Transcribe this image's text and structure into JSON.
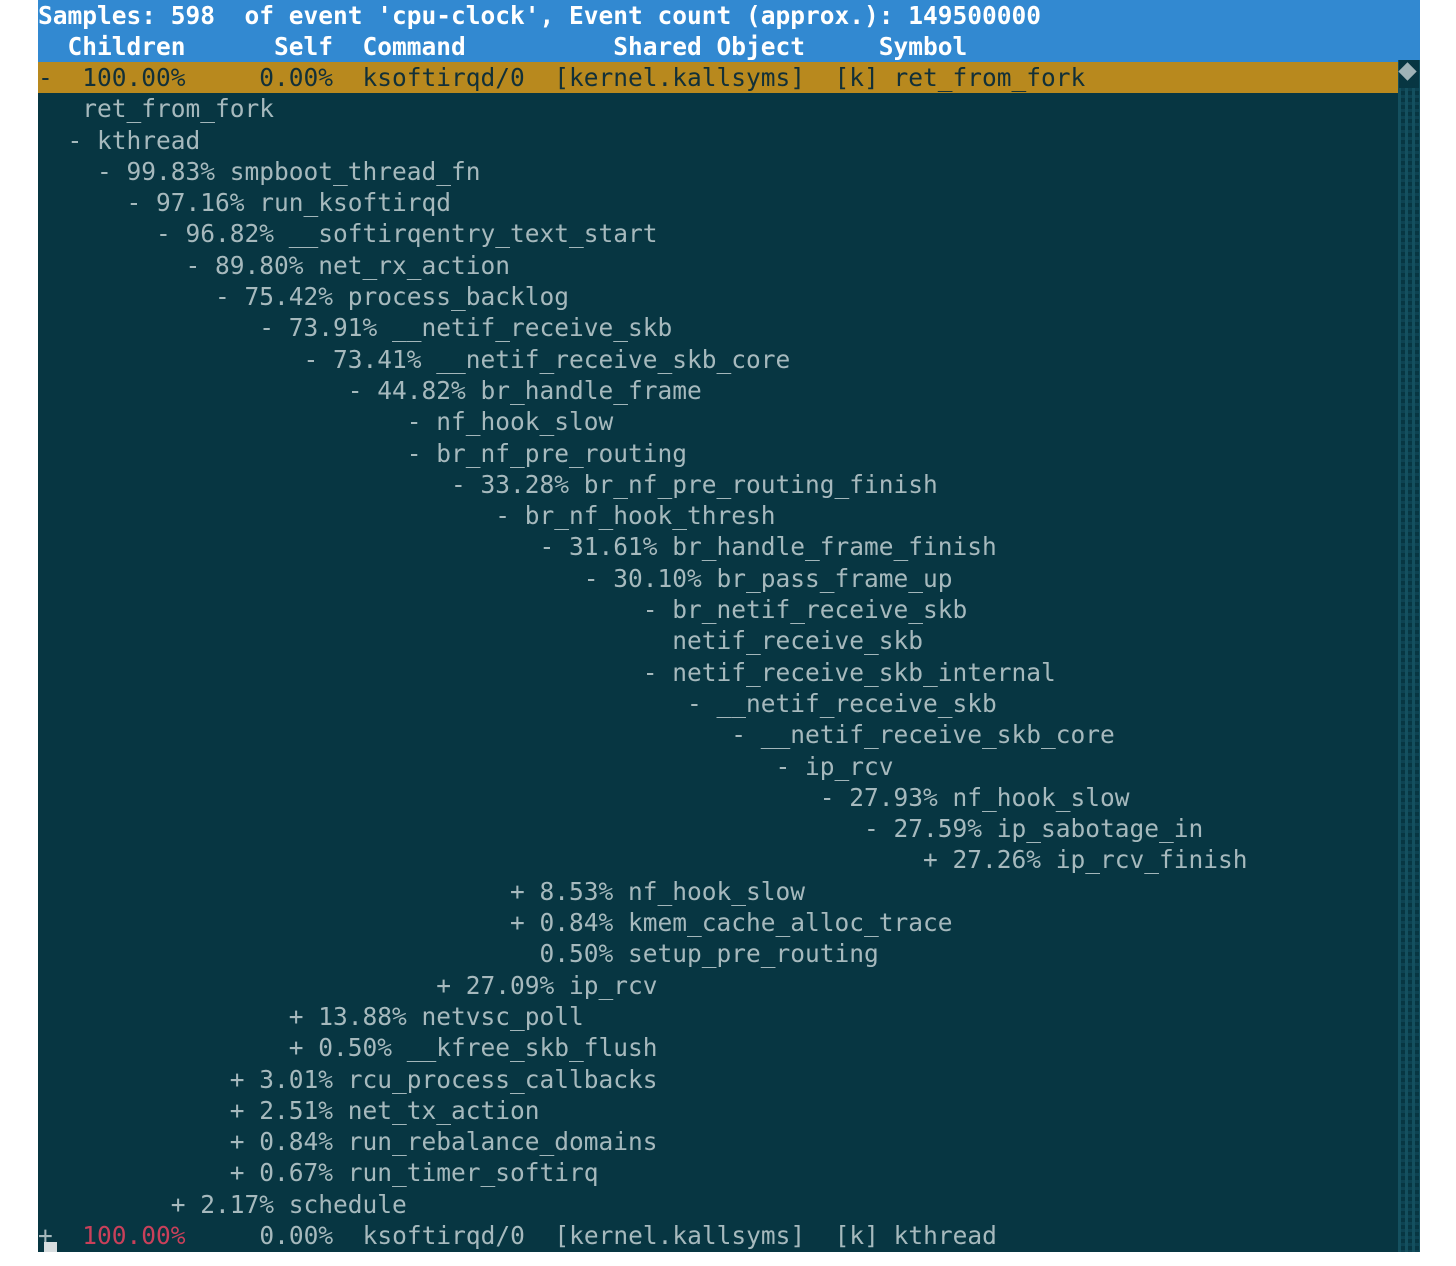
{
  "app": {
    "name": "perf report",
    "colors": {
      "header_bg": "#3289d1",
      "header_fg": "#ffffff",
      "selected_bg": "#b8891e",
      "selected_fg": "#123038",
      "terminal_bg": "#073642",
      "text_fg": "#a6b9bd",
      "accent_red": "#c9405a"
    }
  },
  "header": {
    "summary": "Samples: 598  of event 'cpu-clock', Event count (approx.): 149500000",
    "samples": "598",
    "event": "cpu-clock",
    "event_count": "149500000",
    "columns": {
      "children": "Children",
      "self": "Self",
      "command": "Command",
      "shared_object": "Shared Object",
      "symbol": "Symbol"
    },
    "columns_line": "  Children      Self  Command          Shared Object     Symbol"
  },
  "entries": [
    {
      "marker": "-",
      "children": "100.00%",
      "self": "0.00%",
      "command": "ksoftirqd/0",
      "shared_object": "[kernel.kallsyms]",
      "symbol": "[k] ret_from_fork",
      "line": "-  100.00%     0.00%  ksoftirqd/0  [kernel.kallsyms]  [k] ret_from_fork"
    },
    {
      "marker": "+",
      "children": "100.00%",
      "self": "0.00%",
      "command": "ksoftirqd/0",
      "shared_object": "[kernel.kallsyms]",
      "symbol": "[k] kthread",
      "line": "+  100.00%     0.00%  ksoftirqd/0  [kernel.kallsyms]  [k] kthread"
    }
  ],
  "callchain": [
    {
      "indent": 3,
      "marker": "",
      "pct": "",
      "symbol": "ret_from_fork"
    },
    {
      "indent": 2,
      "marker": "-",
      "pct": "",
      "symbol": "kthread"
    },
    {
      "indent": 4,
      "marker": "-",
      "pct": "99.83%",
      "symbol": "smpboot_thread_fn"
    },
    {
      "indent": 6,
      "marker": "-",
      "pct": "97.16%",
      "symbol": "run_ksoftirqd"
    },
    {
      "indent": 8,
      "marker": "-",
      "pct": "96.82%",
      "symbol": "__softirqentry_text_start"
    },
    {
      "indent": 10,
      "marker": "-",
      "pct": "89.80%",
      "symbol": "net_rx_action"
    },
    {
      "indent": 12,
      "marker": "-",
      "pct": "75.42%",
      "symbol": "process_backlog"
    },
    {
      "indent": 15,
      "marker": "-",
      "pct": "73.91%",
      "symbol": "__netif_receive_skb"
    },
    {
      "indent": 18,
      "marker": "-",
      "pct": "73.41%",
      "symbol": "__netif_receive_skb_core"
    },
    {
      "indent": 21,
      "marker": "-",
      "pct": "44.82%",
      "symbol": "br_handle_frame"
    },
    {
      "indent": 25,
      "marker": "-",
      "pct": "",
      "symbol": "nf_hook_slow"
    },
    {
      "indent": 25,
      "marker": "-",
      "pct": "",
      "symbol": "br_nf_pre_routing"
    },
    {
      "indent": 28,
      "marker": "-",
      "pct": "33.28%",
      "symbol": "br_nf_pre_routing_finish"
    },
    {
      "indent": 31,
      "marker": "-",
      "pct": "",
      "symbol": "br_nf_hook_thresh"
    },
    {
      "indent": 34,
      "marker": "-",
      "pct": "31.61%",
      "symbol": "br_handle_frame_finish"
    },
    {
      "indent": 37,
      "marker": "-",
      "pct": "30.10%",
      "symbol": "br_pass_frame_up"
    },
    {
      "indent": 41,
      "marker": "-",
      "pct": "",
      "symbol": "br_netif_receive_skb"
    },
    {
      "indent": 43,
      "marker": "",
      "pct": "",
      "symbol": "netif_receive_skb"
    },
    {
      "indent": 41,
      "marker": "-",
      "pct": "",
      "symbol": "netif_receive_skb_internal"
    },
    {
      "indent": 44,
      "marker": "-",
      "pct": "",
      "symbol": "__netif_receive_skb"
    },
    {
      "indent": 47,
      "marker": "-",
      "pct": "",
      "symbol": "__netif_receive_skb_core"
    },
    {
      "indent": 50,
      "marker": "-",
      "pct": "",
      "symbol": "ip_rcv"
    },
    {
      "indent": 53,
      "marker": "-",
      "pct": "27.93%",
      "symbol": "nf_hook_slow"
    },
    {
      "indent": 56,
      "marker": "-",
      "pct": "27.59%",
      "symbol": "ip_sabotage_in"
    },
    {
      "indent": 60,
      "marker": "+",
      "pct": "27.26%",
      "symbol": "ip_rcv_finish"
    },
    {
      "indent": 32,
      "marker": "+",
      "pct": "8.53%",
      "symbol": "nf_hook_slow"
    },
    {
      "indent": 32,
      "marker": "+",
      "pct": "0.84%",
      "symbol": "kmem_cache_alloc_trace"
    },
    {
      "indent": 34,
      "marker": "",
      "pct": "0.50%",
      "symbol": "setup_pre_routing"
    },
    {
      "indent": 27,
      "marker": "+",
      "pct": "27.09%",
      "symbol": "ip_rcv"
    },
    {
      "indent": 17,
      "marker": "+",
      "pct": "13.88%",
      "symbol": "netvsc_poll"
    },
    {
      "indent": 17,
      "marker": "+",
      "pct": "0.50%",
      "symbol": "__kfree_skb_flush"
    },
    {
      "indent": 13,
      "marker": "+",
      "pct": "3.01%",
      "symbol": "rcu_process_callbacks"
    },
    {
      "indent": 13,
      "marker": "+",
      "pct": "2.51%",
      "symbol": "net_tx_action"
    },
    {
      "indent": 13,
      "marker": "+",
      "pct": "0.84%",
      "symbol": "run_rebalance_domains"
    },
    {
      "indent": 13,
      "marker": "+",
      "pct": "0.67%",
      "symbol": "run_timer_softirq"
    },
    {
      "indent": 9,
      "marker": "+",
      "pct": "2.17%",
      "symbol": "schedule"
    }
  ],
  "scrollbar": {
    "thumb_icon": "diamond-thumb"
  }
}
